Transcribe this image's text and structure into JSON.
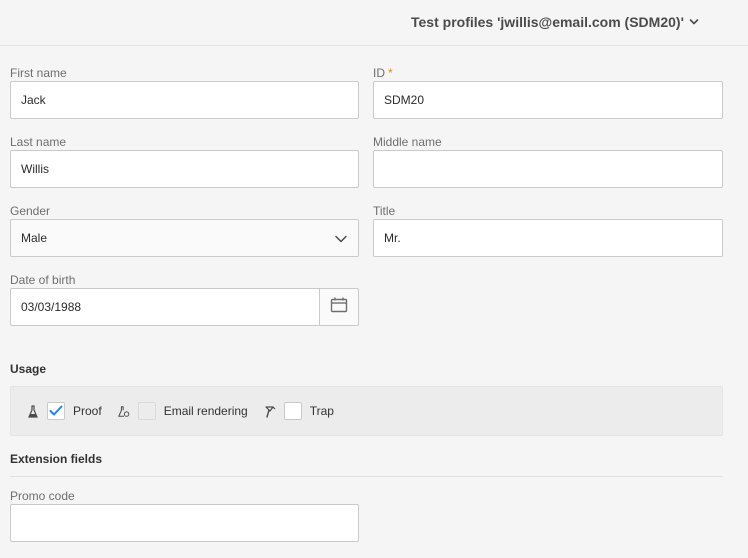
{
  "header": {
    "title": "Test profiles 'jwillis@email.com (SDM20)'",
    "chevron_icon": "chevron-down-icon"
  },
  "form": {
    "first_name": {
      "label": "First name",
      "value": "Jack"
    },
    "id": {
      "label": "ID",
      "required_mark": "*",
      "value": "SDM20"
    },
    "last_name": {
      "label": "Last name",
      "value": "Willis"
    },
    "middle_name": {
      "label": "Middle name",
      "value": ""
    },
    "gender": {
      "label": "Gender",
      "value": "Male"
    },
    "title": {
      "label": "Title",
      "value": "Mr."
    },
    "date_of_birth": {
      "label": "Date of birth",
      "value": "03/03/1988",
      "icon": "calendar-icon"
    }
  },
  "usage": {
    "heading": "Usage",
    "items": [
      {
        "label": "Proof",
        "checked": true,
        "icon": "flask-icon"
      },
      {
        "label": "Email rendering",
        "checked": false,
        "icon": "flask-check-icon"
      },
      {
        "label": "Trap",
        "checked": false,
        "icon": "trap-icon"
      }
    ]
  },
  "extension": {
    "heading": "Extension fields",
    "promo_code": {
      "label": "Promo code",
      "value": ""
    }
  },
  "colors": {
    "checkbox_accent": "#2680eb",
    "required": "#e68619",
    "background": "#f5f5f5"
  }
}
